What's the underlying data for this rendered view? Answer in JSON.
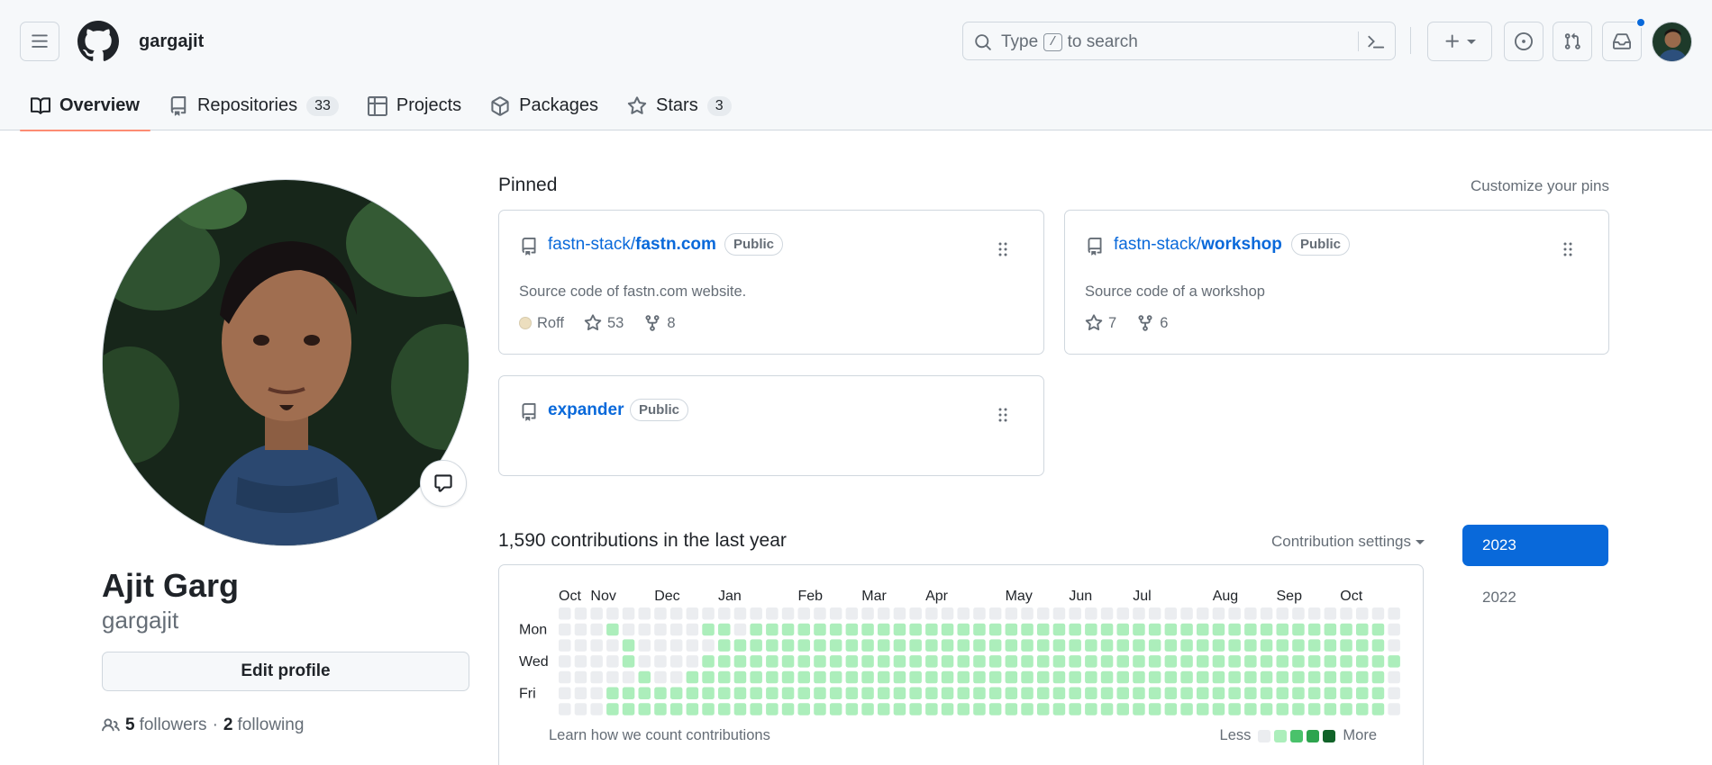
{
  "header": {
    "username": "gargajit",
    "search": {
      "prefix": "Type",
      "key": "/",
      "suffix": "to search"
    },
    "icons": {
      "hamburger": "three-lines-icon",
      "logo": "github-mark-icon",
      "search": "search-icon",
      "command": "command-palette-icon",
      "create": "plus-icon",
      "issues": "issue-opened-icon",
      "pull_requests": "git-pull-request-icon",
      "inbox": "inbox-icon"
    },
    "notification_color": "#0969da"
  },
  "tabs": [
    {
      "label": "Overview",
      "icon": "book-icon",
      "active": true
    },
    {
      "label": "Repositories",
      "icon": "repo-icon",
      "count": "33"
    },
    {
      "label": "Projects",
      "icon": "table-icon"
    },
    {
      "label": "Packages",
      "icon": "package-icon"
    },
    {
      "label": "Stars",
      "icon": "star-icon",
      "count": "3"
    }
  ],
  "profile": {
    "full_name": "Ajit Garg",
    "login": "gargajit",
    "edit_label": "Edit profile",
    "followers_count": "5",
    "followers_label": "followers",
    "separator": "·",
    "following_count": "2",
    "following_label": "following"
  },
  "pinned": {
    "title": "Pinned",
    "customize_label": "Customize your pins",
    "repos": [
      {
        "owner": "fastn-stack/",
        "name": "fastn.com",
        "visibility": "Public",
        "description": "Source code of fastn.com website.",
        "language": "Roff",
        "language_color": "#ecdebe",
        "stars": "53",
        "forks": "8"
      },
      {
        "owner": "fastn-stack/",
        "name": "workshop",
        "visibility": "Public",
        "description": "Source code of a workshop",
        "stars": "7",
        "forks": "6"
      },
      {
        "owner": "",
        "name": "expander",
        "visibility": "Public"
      }
    ]
  },
  "contributions": {
    "title": "1,590 contributions in the last year",
    "settings_label": "Contribution settings",
    "learn_label": "Learn how we count contributions",
    "legend_less": "Less",
    "legend_more": "More",
    "years": [
      "2023",
      "2022"
    ],
    "months": [
      {
        "label": "Oct",
        "week": 0
      },
      {
        "label": "Nov",
        "week": 2
      },
      {
        "label": "Dec",
        "week": 6
      },
      {
        "label": "Jan",
        "week": 10
      },
      {
        "label": "Feb",
        "week": 15
      },
      {
        "label": "Mar",
        "week": 19
      },
      {
        "label": "Apr",
        "week": 23
      },
      {
        "label": "May",
        "week": 28
      },
      {
        "label": "Jun",
        "week": 32
      },
      {
        "label": "Jul",
        "week": 36
      },
      {
        "label": "Aug",
        "week": 41
      },
      {
        "label": "Sep",
        "week": 45
      },
      {
        "label": "Oct",
        "week": 49
      }
    ],
    "day_labels": [
      "",
      "Mon",
      "",
      "Wed",
      "",
      "Fri",
      ""
    ],
    "level_colors": [
      "#ebedf0",
      "#aceebb",
      "#4ac26b",
      "#2da44e",
      "#116329"
    ],
    "grid": [
      "00000000000000000000000000000000000000000000000000000",
      "00010000011011111111111111111111111111111111111111110",
      "00001000001111111111111111111111111111111111111111110",
      "00001000011111111111111111111111111111111111111111111",
      "00000100111111111111111111111111111111111111111111110",
      "00011111111111111111111111111111111111111111111111110",
      "00011111111111111111111111111111111111111111111111110"
    ]
  }
}
